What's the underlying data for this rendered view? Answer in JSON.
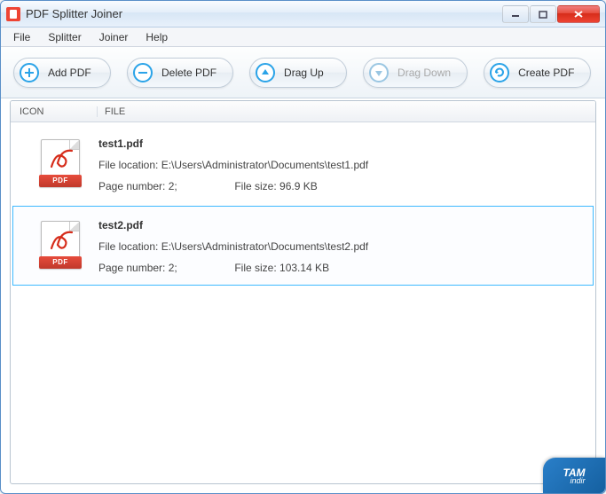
{
  "window": {
    "title": "PDF Splitter Joiner"
  },
  "menu": {
    "file": "File",
    "splitter": "Splitter",
    "joiner": "Joiner",
    "help": "Help"
  },
  "toolbar": {
    "add": "Add PDF",
    "delete": "Delete PDF",
    "dragup": "Drag Up",
    "dragdown": "Drag Down",
    "create": "Create PDF"
  },
  "headers": {
    "icon": "ICON",
    "file": "FILE"
  },
  "labels": {
    "location_prefix": "File location: ",
    "page_prefix": "Page number: ",
    "size_prefix": "File size: ",
    "pdf_badge": "PDF"
  },
  "files": [
    {
      "name": "test1.pdf",
      "location": "E:\\Users\\Administrator\\Documents\\test1.pdf",
      "pages": "2;",
      "size": "96.9 KB",
      "selected": false
    },
    {
      "name": "test2.pdf",
      "location": "E:\\Users\\Administrator\\Documents\\test2.pdf",
      "pages": "2;",
      "size": "103.14 KB",
      "selected": true
    }
  ],
  "watermark": {
    "brand": "TAM",
    "sub": "indir"
  },
  "colors": {
    "add": "#2aa3e8",
    "delete": "#2aa3e8",
    "dragup": "#2aa3e8",
    "dragdown": "#9ac6e2",
    "create": "#2aa3e8"
  }
}
